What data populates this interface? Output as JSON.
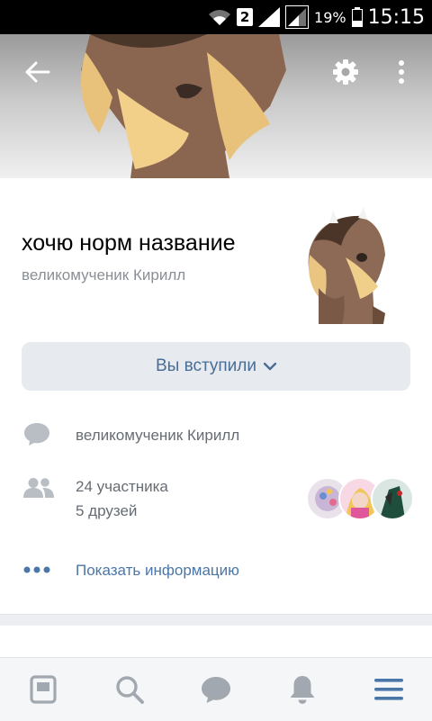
{
  "statusbar": {
    "sim": "2",
    "battery": "19%",
    "time": "15:15"
  },
  "group": {
    "name": "хочю норм название",
    "admin": "великомученик Кирилл",
    "join_status": "Вы вступили"
  },
  "info": {
    "description": "великомученик Кирилл",
    "members": "24 участника",
    "friends": "5 друзей",
    "show_more": "Показать информацию"
  },
  "colors": {
    "accent": "#4a76a8",
    "button_bg": "#e7eaef",
    "icon_gray": "#b9bec5"
  },
  "nav": {
    "items": [
      {
        "icon": "news-icon"
      },
      {
        "icon": "search-icon"
      },
      {
        "icon": "messages-icon"
      },
      {
        "icon": "notifications-icon"
      },
      {
        "icon": "menu-icon"
      }
    ]
  }
}
